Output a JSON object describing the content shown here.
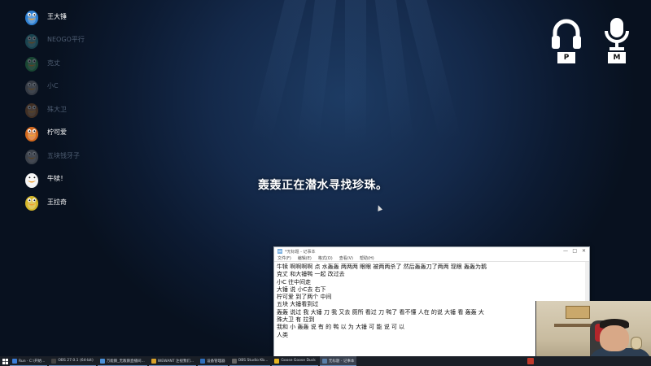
{
  "players": [
    {
      "name": "王大锤",
      "status": "alive",
      "color": "#2e7fd0"
    },
    {
      "name": "NEOGO平行",
      "status": "dead",
      "color": "#3aa0a8"
    },
    {
      "name": "克丈",
      "status": "dead",
      "color": "#3aa85a"
    },
    {
      "name": "小C",
      "status": "dead",
      "color": "#888888"
    },
    {
      "name": "殊大卫",
      "status": "dead",
      "color": "#a8692e"
    },
    {
      "name": "柠可爱",
      "status": "alive",
      "color": "#d2691e"
    },
    {
      "name": "五块钱牙子",
      "status": "dead",
      "color": "#9a9a9a"
    },
    {
      "name": "牛犊！",
      "status": "alive",
      "color": "#f4f4f4"
    },
    {
      "name": "王拉奇",
      "status": "alive",
      "color": "#d4b62a"
    }
  ],
  "voice": {
    "headphones_icon": "headphones-icon",
    "headphones_key": "P",
    "mic_icon": "microphone-icon",
    "mic_key": "M"
  },
  "status_message": "轰轰正在潜水寻找珍珠。",
  "notepad": {
    "title": "*无标题 - 记事本",
    "controls": [
      "—",
      "□",
      "✕"
    ],
    "menu": [
      "文件(F)",
      "编辑(E)",
      "格式(O)",
      "查看(V)",
      "帮助(H)"
    ],
    "lines": [
      "牛犊 啊啊啊啊 点 水轰轰 两两两 眼眼 被两两杀了 然后轰轰刀了两两 现眼 轰轰为鹅",
      "克丈 和大锤鸭 一起 改过去",
      "小C 往中间走",
      "大锤 说 小C去 右下",
      "柠可爱 到了两个 中间",
      "五块 大锤看到过",
      "轰轰 说过 我 大锤 刀 我 又去 厕所 看过 刀 鸭了 看不懂 人在 的说 大锤 看 轰轰 大",
      "殊大卫 有 拉到",
      "我和 小 轰轰 说 有 的 鸭 以 为 大锤 可 能 说 可 以",
      "人类"
    ]
  },
  "taskbar": {
    "items": [
      {
        "label": "Run · C:\\开始...",
        "color": "#3b7dd8"
      },
      {
        "label": "OBS 27.0.1 (64-bit)",
        "color": "#444444"
      },
      {
        "label": "万能鹅_无敌鹅直播间...",
        "color": "#4a90d9"
      },
      {
        "label": "WEWANT 注视我们...",
        "color": "#d8a12a"
      },
      {
        "label": "设备管理器",
        "color": "#2f6fbd"
      },
      {
        "label": "OBS Studio Kb...",
        "color": "#666666"
      },
      {
        "label": "Goose Goose Duck",
        "color": "#e6b422"
      },
      {
        "label": "无标题 - 记事本",
        "color": "#5a7fa8"
      }
    ]
  },
  "webcam": {
    "label": "streamer-webcam"
  }
}
